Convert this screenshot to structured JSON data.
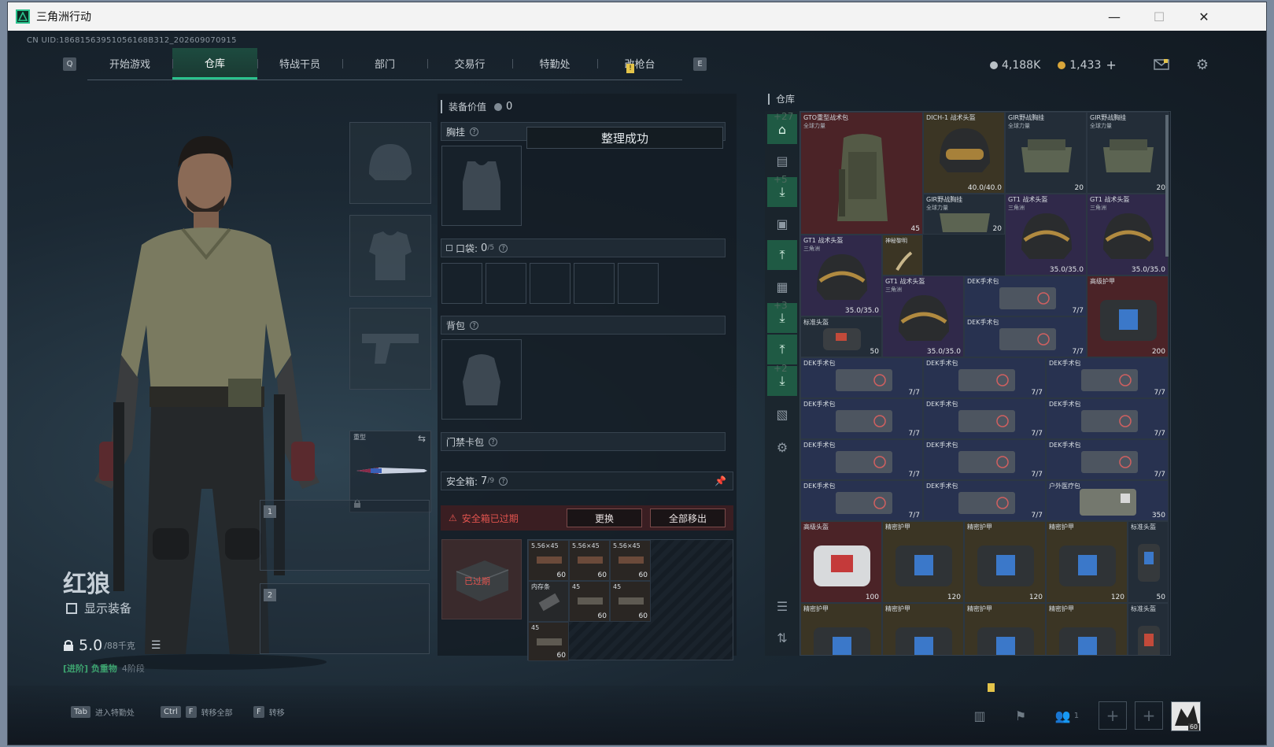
{
  "window": {
    "title": "三角洲行动",
    "minimize": "—",
    "maximize": "☐",
    "close": "✕"
  },
  "uid": "CN UID:18681563951056168B312_202609070915",
  "nav": {
    "key_left": "Q",
    "key_right": "E",
    "tabs": [
      "开始游戏",
      "仓库",
      "特战干员",
      "部门",
      "交易行",
      "特勤处",
      "改枪台"
    ],
    "active_tab": "仓库",
    "notify": "!"
  },
  "currency": {
    "silver": "4,188K",
    "gold": "1,433",
    "add": "+",
    "silver_color": "#b9c0c6",
    "gold_color": "#d9a63a"
  },
  "character": {
    "name": "红狼",
    "show_equipment": "显示装备",
    "weight": "5.0",
    "weight_cap": "/88千克",
    "rank": "[进阶] 负重物",
    "rank_level": "4阶段"
  },
  "slots": {
    "melee_label": "重型",
    "slot1": "1",
    "slot2": "2"
  },
  "loadout": {
    "value_label": "装备价值",
    "value": "0",
    "chest_rig": "胸挂",
    "toast": "整理成功",
    "pockets": "口袋:",
    "pockets_value": "0",
    "pockets_cap": "/5",
    "backpack": "背包",
    "keycard": "门禁卡包",
    "safebox": "安全箱:",
    "safebox_value": "7",
    "safebox_cap": "/9",
    "safebox_expired": "安全箱已过期",
    "replace": "更换",
    "move_all": "全部移出",
    "expired_tag": "已过期",
    "ammo_label": "5.56×45",
    "ammo_count": "60",
    "ammo_label2": "45",
    "ammo_label3": "内存条"
  },
  "warehouse": {
    "title": "仓库",
    "side_plus": [
      "+27",
      "+5",
      "+3",
      "+2"
    ],
    "items": [
      {
        "name": "GTO重型战术包",
        "sub": "全球力量",
        "val": "45"
      },
      {
        "name": "DICH-1 战术头盔",
        "sub": "",
        "val": "40.0/40.0"
      },
      {
        "name": "GIR野战胸挂",
        "sub": "全球力量",
        "val": "20"
      },
      {
        "name": "GIR野战胸挂",
        "sub": "全球力量",
        "val": "20"
      },
      {
        "name": "GIR野战胸挂",
        "sub": "全球力量",
        "val": "20"
      },
      {
        "name": "GT1 战术头盔",
        "sub": "三角洲",
        "val": "35.0/35.0"
      },
      {
        "name": "GT1 战术头盔",
        "sub": "三角洲",
        "val": "35.0/35.0"
      },
      {
        "name": "GT1 战术头盔",
        "sub": "三角洲",
        "val": "35.0/35.0"
      },
      {
        "name": "神秘黎明",
        "sub": "",
        "val": ""
      },
      {
        "name": "GT1 战术头盔",
        "sub": "三角洲",
        "val": "35.0/35.0"
      },
      {
        "name": "DEK手术包",
        "sub": "",
        "val": "7/7"
      },
      {
        "name": "高级护甲",
        "sub": "",
        "val": "200"
      },
      {
        "name": "标准头盔",
        "sub": "",
        "val": "50"
      },
      {
        "name": "DEK手术包",
        "sub": "",
        "val": "7/7"
      },
      {
        "name": "户外医疗包",
        "sub": "",
        "val": "350"
      },
      {
        "name": "高级头盔",
        "sub": "",
        "val": "100"
      },
      {
        "name": "精密护甲",
        "sub": "",
        "val": "120"
      },
      {
        "name": "标准头盔",
        "sub": "",
        "val": "50"
      }
    ]
  },
  "bottom": {
    "tab_key": "Tab",
    "tab_label": "进入特勤处",
    "ctrl_key": "Ctrl",
    "f_key": "F",
    "transfer_all": "转移全部",
    "transfer": "转移",
    "squad_count": "1",
    "avatar_level": "60"
  }
}
